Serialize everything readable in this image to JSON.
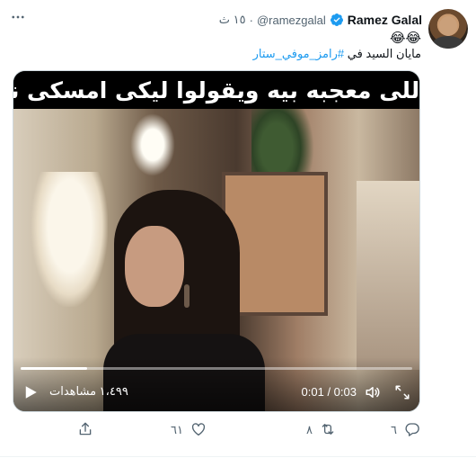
{
  "tweet": {
    "author_name": "Ramez Galal",
    "handle": "@ramezgalal",
    "separator": "·",
    "time": "١٥ ث",
    "emoji": "😂😂",
    "caption_prefix": "مايان السيد في",
    "hashtag": "#رامز_موفي_ستار"
  },
  "video": {
    "banner_text": "لما تقابلي اللى معجبه بيه ويقولوا ليكى امسكى نفسك شويه",
    "views": "١،٤٩٩ مشاهدات",
    "time_display": "0:01 / 0:03",
    "progress_fraction": 0.17
  },
  "actions": {
    "reply_count": "٦",
    "retweet_count": "٨",
    "like_count": "٦١",
    "share_count": ""
  },
  "colors": {
    "accent": "#1d9bf0",
    "secondary_text": "#536471",
    "primary_text": "#0f1419"
  },
  "icons": {
    "verified": "verified-badge-icon",
    "more": "more-icon",
    "play": "play-icon",
    "volume": "volume-icon",
    "fullscreen": "fullscreen-icon",
    "reply": "reply-icon",
    "retweet": "retweet-icon",
    "like": "like-icon",
    "share": "share-icon"
  }
}
